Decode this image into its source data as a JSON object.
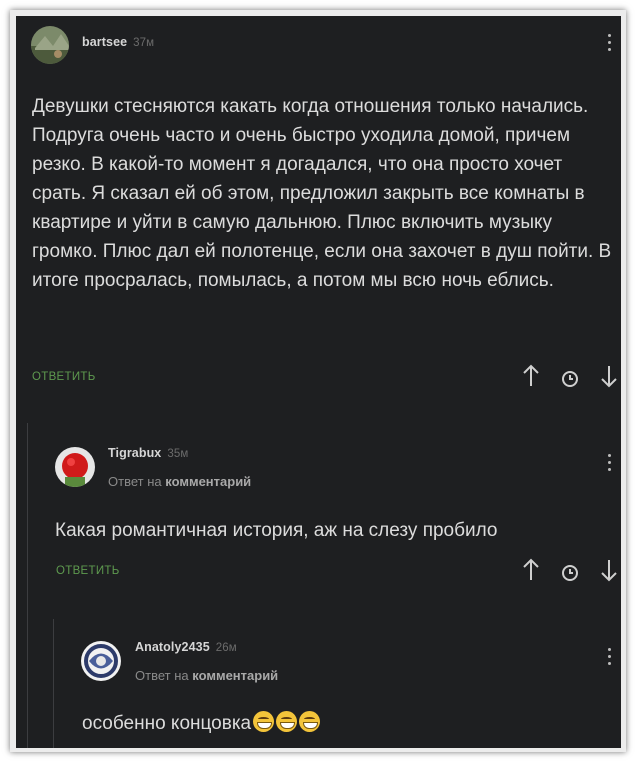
{
  "comments": [
    {
      "username": "bartsee",
      "time": "37м",
      "text": "Девушки стесняются какать когда отношения только начались. Подруга очень часто и очень быстро уходила домой, причем резко. В какой-то момент я догадался, что она просто хочет срать. Я сказал ей об этом, предложил закрыть все комнаты в квартире и уйти в самую дальнюю. Плюс включить музыку громко. Плюс дал ей полотенце, если она захочет в душ пойти. В итоге просралась, помылась, а потом мы всю ночь еблись.",
      "reply_label": "ОТВЕТИТЬ"
    },
    {
      "username": "Tigrabux",
      "time": "35м",
      "reply_prefix": "Ответ на",
      "reply_target": "комментарий",
      "text": "Какая романтичная история, аж на слезу пробило",
      "reply_label": "ОТВЕТИТЬ"
    },
    {
      "username": "Anatoly2435",
      "time": "26м",
      "reply_prefix": "Ответ на",
      "reply_target": "комментарий",
      "text": "особенно концовка",
      "emoji": "grinning-face-emoji"
    }
  ],
  "icons": {
    "upvote": "arrow-up-icon",
    "save": "clock-icon",
    "downvote": "arrow-down-icon",
    "menu": "kebab-menu-icon"
  },
  "colors": {
    "background": "#1e1f21",
    "reply_accent": "#5e9a4f",
    "text": "#dcdcdc"
  }
}
